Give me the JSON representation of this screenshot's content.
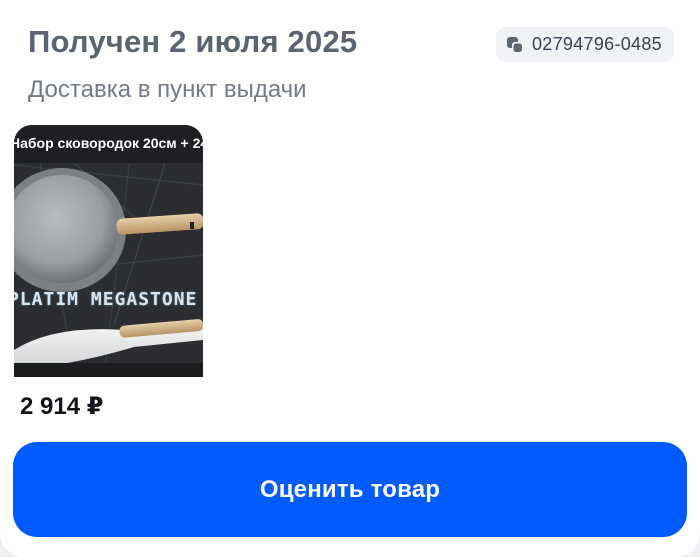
{
  "order": {
    "status_title": "Получен 2 июля 2025",
    "number": "02794796-0485",
    "copy_icon": "copy-icon",
    "delivery_type": "Доставка в пункт выдачи"
  },
  "product": {
    "image_banner_text": "Набор сковородок 20см + 24",
    "image_brand_text": "PLATIM MEGASTONE",
    "price": "2 914 ₽"
  },
  "actions": {
    "rate_label": "Оценить товар"
  },
  "colors": {
    "accent": "#005bff",
    "title": "#5b6470",
    "subtitle": "#737b86"
  }
}
